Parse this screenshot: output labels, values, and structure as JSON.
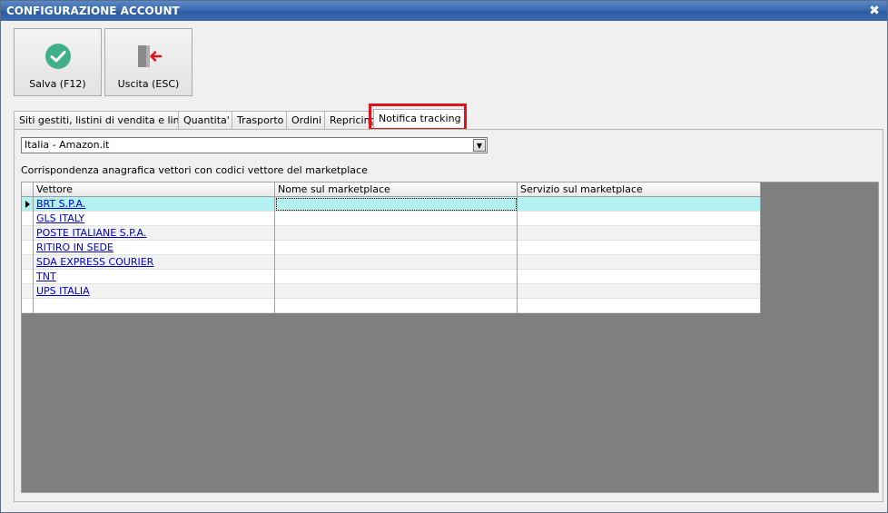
{
  "window": {
    "title": "CONFIGURAZIONE ACCOUNT",
    "close_glyph": "✖"
  },
  "toolbar": {
    "save_label": "Salva (F12)",
    "exit_label": "Uscita (ESC)",
    "save_icon": "check-circle-icon",
    "exit_icon": "door-exit-icon",
    "save_color": "#3fb08a",
    "exit_color": "#e0141c"
  },
  "tabs": [
    {
      "label": "Siti gestiti, listini di vendita e lingue"
    },
    {
      "label": "Quantita'"
    },
    {
      "label": "Trasporto"
    },
    {
      "label": "Ordini"
    },
    {
      "label": "Repricing"
    },
    {
      "label": "Notifica tracking",
      "active": true
    }
  ],
  "marketplace_select": {
    "value": "Italia - Amazon.it"
  },
  "grid": {
    "caption": "Corrispondenza anagrafica vettori con codici vettore del marketplace",
    "columns": [
      "Vettore",
      "Nome sul marketplace",
      "Servizio sul marketplace"
    ],
    "rows": [
      {
        "vettore": "BRT S.P.A.",
        "nome": "",
        "servizio": ""
      },
      {
        "vettore": "GLS ITALY",
        "nome": "",
        "servizio": ""
      },
      {
        "vettore": "POSTE ITALIANE S.P.A.",
        "nome": "",
        "servizio": ""
      },
      {
        "vettore": "RITIRO IN SEDE",
        "nome": "",
        "servizio": ""
      },
      {
        "vettore": "SDA EXPRESS COURIER",
        "nome": "",
        "servizio": ""
      },
      {
        "vettore": "TNT",
        "nome": "",
        "servizio": ""
      },
      {
        "vettore": "UPS ITALIA",
        "nome": "",
        "servizio": ""
      },
      {
        "vettore": "",
        "nome": "",
        "servizio": ""
      }
    ]
  },
  "colors": {
    "highlight_box": "#e0141c",
    "selected_row": "#b3f0f0",
    "titlebar": "#3b6bb0"
  }
}
